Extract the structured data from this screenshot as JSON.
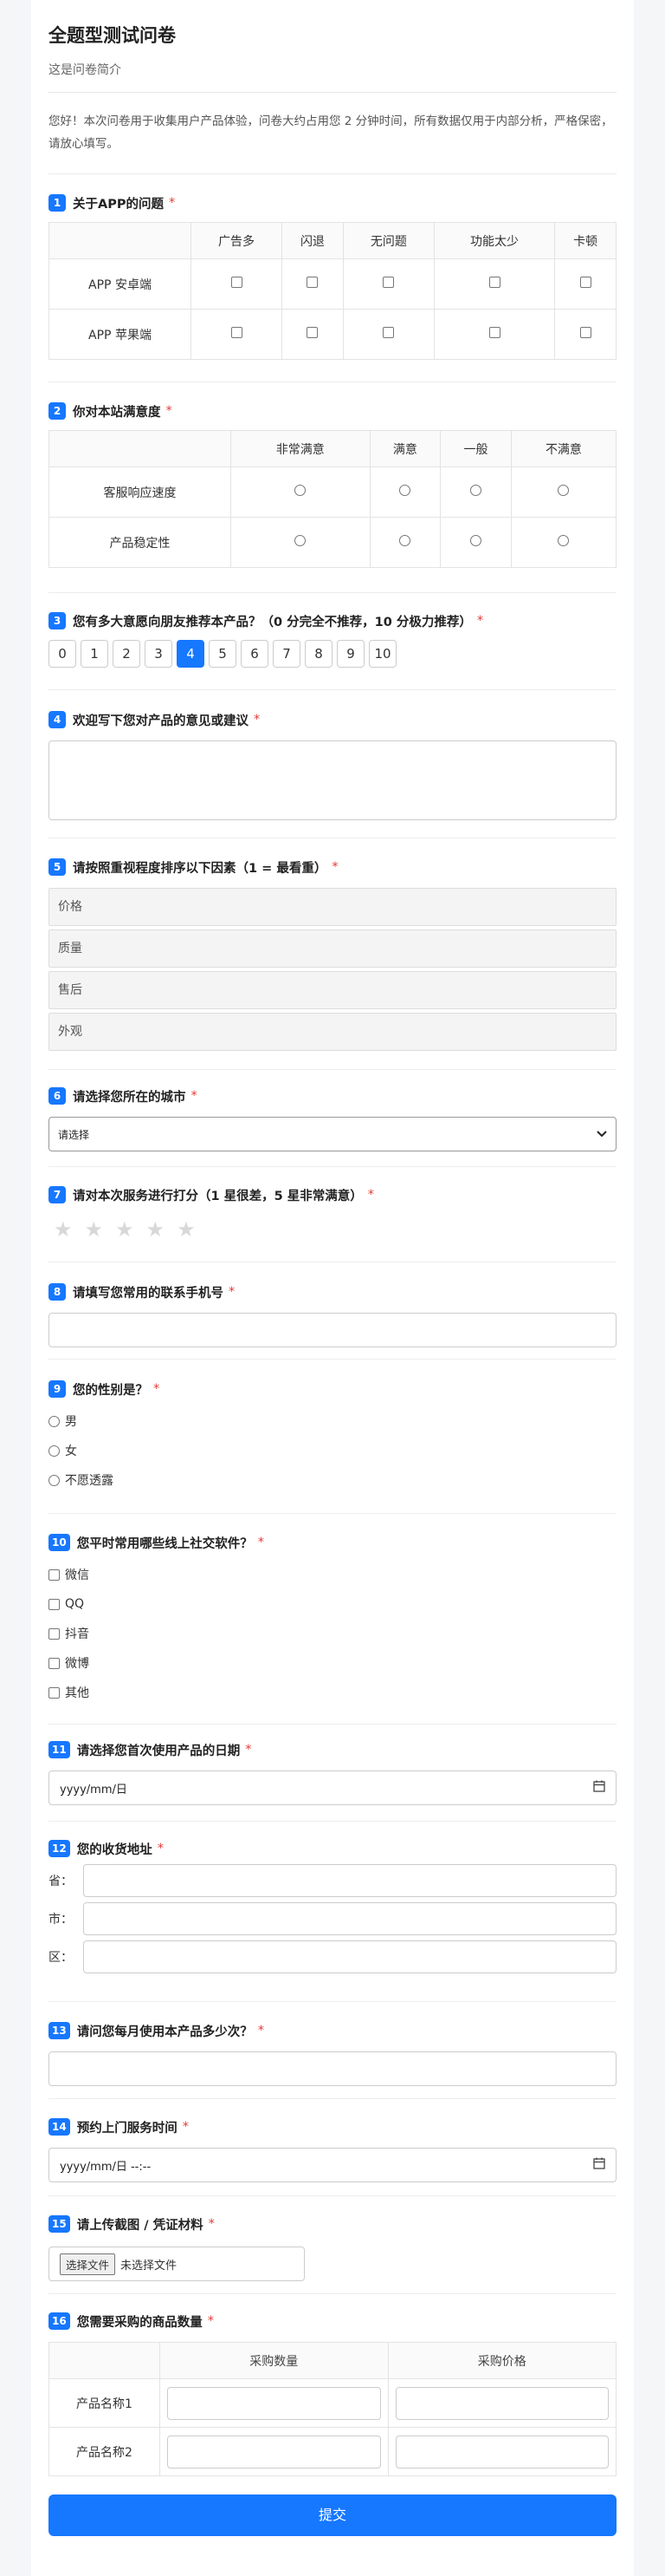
{
  "survey": {
    "title": "全题型测试问卷",
    "subtitle": "这是问卷简介",
    "intro": "您好！本次问卷用于收集用户产品体验，问卷大约占用您 2 分钟时间，所有数据仅用于内部分析，严格保密，请放心填写。"
  },
  "q1": {
    "num": "1",
    "title": "关于APP的问题",
    "req": "*",
    "cols": [
      "广告多",
      "闪退",
      "无问题",
      "功能太少",
      "卡顿"
    ],
    "rows": [
      "APP 安卓端",
      "APP 苹果端"
    ]
  },
  "q2": {
    "num": "2",
    "title": "你对本站满意度",
    "req": "*",
    "cols": [
      "非常满意",
      "满意",
      "一般",
      "不满意"
    ],
    "rows": [
      "客服响应速度",
      "产品稳定性"
    ]
  },
  "q3": {
    "num": "3",
    "title": "您有多大意愿向朋友推荐本产品？（0 分完全不推荐，10 分极力推荐）",
    "req": "*",
    "scale": [
      "0",
      "1",
      "2",
      "3",
      "4",
      "5",
      "6",
      "7",
      "8",
      "9",
      "10"
    ],
    "selected": "4"
  },
  "q4": {
    "num": "4",
    "title": "欢迎写下您对产品的意见或建议",
    "req": "*"
  },
  "q5": {
    "num": "5",
    "title": "请按照重视程度排序以下因素（1 = 最看重）",
    "req": "*",
    "items": [
      "价格",
      "质量",
      "售后",
      "外观"
    ]
  },
  "q6": {
    "num": "6",
    "title": "请选择您所在的城市",
    "req": "*",
    "selected": "请选择"
  },
  "q7": {
    "num": "7",
    "title": "请对本次服务进行打分（1 星很差，5 星非常满意）",
    "req": "*",
    "stars": "★★★★★"
  },
  "q8": {
    "num": "8",
    "title": "请填写您常用的联系手机号",
    "req": "*"
  },
  "q9": {
    "num": "9",
    "title": "您的性别是？",
    "req": "*",
    "options": [
      "男",
      "女",
      "不愿透露"
    ]
  },
  "q10": {
    "num": "10",
    "title": "您平时常用哪些线上社交软件？",
    "req": "*",
    "options": [
      "微信",
      "QQ",
      "抖音",
      "微博",
      "其他"
    ]
  },
  "q11": {
    "num": "11",
    "title": "请选择您首次使用产品的日期",
    "req": "*",
    "placeholder": "yyyy/mm/日"
  },
  "q12": {
    "num": "12",
    "title": "您的收货地址",
    "req": "*",
    "labels": [
      "省：",
      "市：",
      "区："
    ]
  },
  "q13": {
    "num": "13",
    "title": "请问您每月使用本产品多少次？",
    "req": "*"
  },
  "q14": {
    "num": "14",
    "title": "预约上门服务时间",
    "req": "*",
    "placeholder": "yyyy/mm/日 --:--"
  },
  "q15": {
    "num": "15",
    "title": "请上传截图 / 凭证材料",
    "req": "*",
    "button": "选择文件",
    "status": "未选择文件"
  },
  "q16": {
    "num": "16",
    "title": "您需要采购的商品数量",
    "req": "*",
    "cols": [
      "采购数量",
      "采购价格"
    ],
    "rows": [
      "产品名称1",
      "产品名称2"
    ]
  },
  "submit": "提交",
  "colors": {
    "accent": "#1677ff",
    "required": "#e53935"
  }
}
